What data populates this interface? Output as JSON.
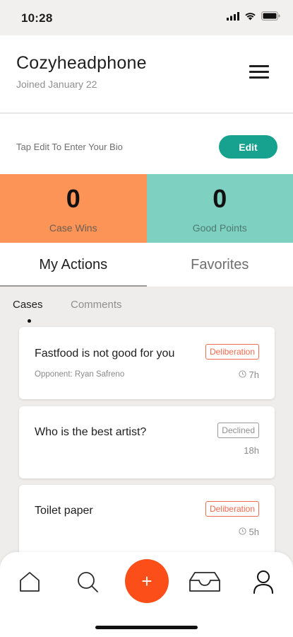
{
  "status_bar": {
    "time": "10:28"
  },
  "profile": {
    "name": "Cozyheadphone",
    "joined": "Joined January 22"
  },
  "bio": {
    "prompt": "Tap Edit To Enter Your Bio",
    "edit_label": "Edit"
  },
  "stats": {
    "case_wins": {
      "value": "0",
      "label": "Case Wins",
      "color": "#fc9458"
    },
    "good_points": {
      "value": "0",
      "label": "Good Points",
      "color": "#7ed0c0"
    }
  },
  "tabs": {
    "my_actions": "My Actions",
    "favorites": "Favorites"
  },
  "subtabs": {
    "cases": "Cases",
    "comments": "Comments"
  },
  "cases": [
    {
      "title": "Fastfood is not good for you",
      "opponent": "Opponent: Ryan Safreno",
      "status": "Deliberation",
      "time": "7h"
    },
    {
      "title": "Who is the best artist?",
      "opponent": "",
      "status": "Declined",
      "time": "18h"
    },
    {
      "title": "Toilet paper",
      "opponent": "",
      "status": "Deliberation",
      "time": "5h"
    }
  ],
  "bottom_nav": {
    "items": [
      "home-icon",
      "search-icon",
      "add-icon",
      "inbox-icon",
      "profile-icon"
    ],
    "fab_glyph": "+"
  },
  "colors": {
    "accent": "#16a28e",
    "fab": "#fc4e19",
    "deliberation": "#f06a4f"
  }
}
